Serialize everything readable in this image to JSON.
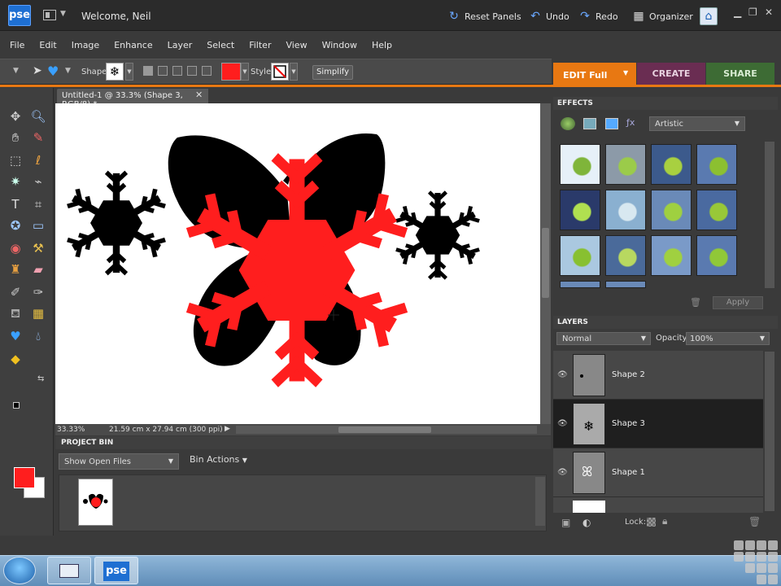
{
  "titlebar": {
    "logo": "pse",
    "welcome": "Welcome, Neil",
    "reset_panels": "Reset Panels",
    "undo": "Undo",
    "redo": "Redo",
    "organizer": "Organizer"
  },
  "menubar": [
    "File",
    "Edit",
    "Image",
    "Enhance",
    "Layer",
    "Select",
    "Filter",
    "View",
    "Window",
    "Help"
  ],
  "options": {
    "shape_label": "Shape:",
    "style_label": "Style:",
    "simplify": "Simplify",
    "color": "#ff1e1e"
  },
  "mode_tabs": {
    "edit": "EDIT Full",
    "create": "CREATE",
    "share": "SHARE"
  },
  "document": {
    "tab_title": "Untitled-1 @ 33.3% (Shape 3, RGB/8) *",
    "zoom": "33.33%",
    "size_info": "21.59 cm x 27.94 cm (300 ppi)"
  },
  "project_bin": {
    "header": "PROJECT BIN",
    "show": "Show Open Files",
    "actions": "Bin Actions"
  },
  "effects": {
    "header": "EFFECTS",
    "category": "Artistic",
    "apply": "Apply"
  },
  "layers": {
    "header": "LAYERS",
    "blend_mode": "Normal",
    "opacity_label": "Opacity:",
    "opacity": "100%",
    "lock_label": "Lock:",
    "items": [
      {
        "name": "Shape 2"
      },
      {
        "name": "Shape 3"
      },
      {
        "name": "Shape 1"
      }
    ]
  },
  "taskbar": {
    "pse_label": "pse"
  },
  "colors": {
    "accent_orange": "#e87812",
    "create_purple": "#6a2d52",
    "share_green": "#3d6b34",
    "shape_red": "#ff1e1e"
  }
}
